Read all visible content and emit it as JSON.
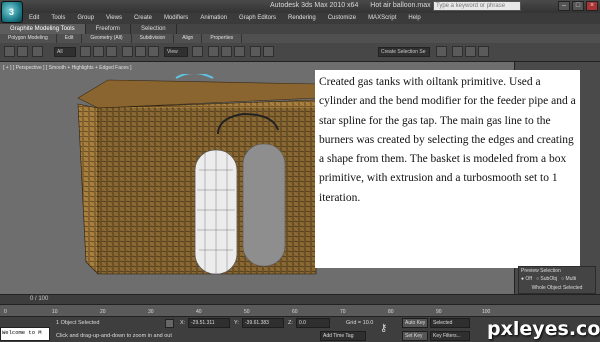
{
  "titlebar": {
    "app_title": "Autodesk 3ds Max  2010 x64",
    "file_name": "Hot air balloon.max",
    "search_placeholder": "Type a keyword or phrase"
  },
  "menu": [
    "Edit",
    "Tools",
    "Group",
    "Views",
    "Create",
    "Modifiers",
    "Animation",
    "Graph Editors",
    "Rendering",
    "Customize",
    "MAXScript",
    "Help"
  ],
  "ribbon": {
    "tabs": [
      "Graphite Modeling Tools",
      "Freeform",
      "Selection"
    ],
    "subtabs": [
      "Polygon Modeling",
      "Edit",
      "Geometry (All)",
      "Subdivision",
      "Align",
      "Properties"
    ]
  },
  "toolbar": {
    "filter_value": "All",
    "view_value": "View",
    "named_selection": "Create Selection Se"
  },
  "viewport": {
    "label": "[ + ] [ Perspective ] [ Smooth + Highlights + Edged Faces ]"
  },
  "caption": "Created gas tanks with oiltank primitive. Used a cylinder and the bend modifier for the feeder pipe and a star spline for the gas tap.  The main gas line to the burners was created by selecting the edges and creating a shape from them. The basket is modeled from a box primitive, with extrusion and a turbosmooth set to 1 iteration.",
  "right_panel": {
    "preview_title": "Preview Selection",
    "radio_off": "Off",
    "radio_subobj": "SubObj",
    "radio_multi": "Multi",
    "whole_object": "Whole Object Selected"
  },
  "timeline": {
    "frame_label": "0 / 100",
    "ticks": [
      "0",
      "10",
      "20",
      "30",
      "40",
      "50",
      "60",
      "70",
      "80",
      "90",
      "100"
    ]
  },
  "status": {
    "listener": "Welcome to M",
    "selection_info": "1 Object Selected",
    "prompt": "Click and drag-up-and-down to zoom in and out",
    "x_label": "X:",
    "x_value": "-29.51.311",
    "y_label": "Y:",
    "y_value": "-39.61.383",
    "z_label": "Z:",
    "z_value": "0.0",
    "grid": "Grid = 10.0",
    "auto_key": "Auto Key",
    "set_key": "Set Key",
    "key_mode": "Selected",
    "key_filters": "Key Filters...",
    "add_time_tag": "Add Time Tag"
  },
  "watermark": "pxleyes.com"
}
